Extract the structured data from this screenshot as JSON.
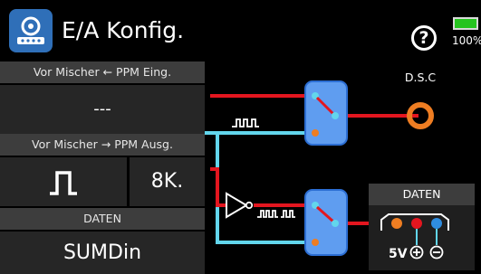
{
  "header": {
    "title": "E/A Konfig.",
    "battery_text": "100%"
  },
  "left_panel": {
    "input_section_label": "Vor Mischer ← PPM Eing.",
    "input_value": "---",
    "output_section_label": "Vor Mischer → PPM Ausg.",
    "output_channels": "8K.",
    "data_section_label": "DATEN",
    "data_mode": "SUMDin"
  },
  "diagram": {
    "dsc_label": "D.S.C",
    "data_port_label": "DATEN",
    "voltage_label": "5V",
    "plus_symbol": "⊕",
    "minus_symbol": "⊖"
  },
  "icons": [
    "app-icon",
    "help-icon",
    "battery-icon",
    "ppm-pulse-icon"
  ],
  "colors": {
    "red_line": "#e3161f",
    "cyan_line": "#62d6ec",
    "switch_block": "#5f9df0",
    "orange_socket": "#ee7d22",
    "battery_green": "#26c41f"
  }
}
